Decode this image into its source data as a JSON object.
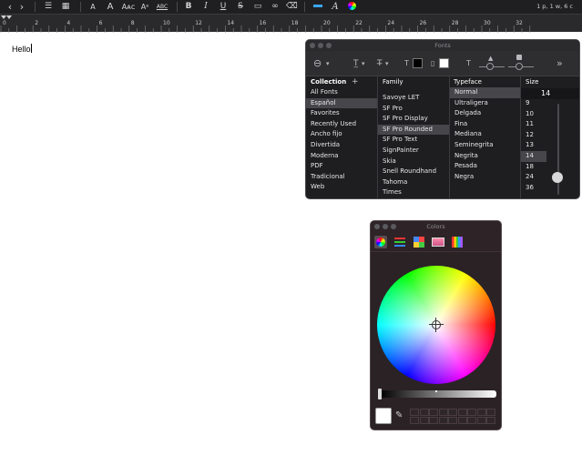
{
  "toolbar": {
    "status": "1 p, 1 w, 6 c",
    "icons": [
      "chevron-left-icon",
      "chevron-right-icon",
      "list-icon",
      "table-icon",
      "text-size-icon",
      "text-size-large-icon",
      "small-caps-icon",
      "superscript-icon",
      "strikethrough-abc-icon",
      "bold-icon",
      "italic-icon",
      "underline-icon",
      "strikethrough-icon",
      "comment-icon",
      "link-icon",
      "clear-format-icon",
      "highlight-icon",
      "font-panel-icon",
      "color-panel-icon"
    ],
    "glyph_labels": {
      "aa": "A",
      "abc_small": "Aᴀᴄ",
      "abc_strike": "ABC",
      "bold": "B",
      "italic": "I",
      "underline": "U",
      "strike": "S"
    }
  },
  "ruler": {
    "labels": [
      "0",
      "2",
      "4",
      "6",
      "8",
      "10",
      "12",
      "14",
      "16",
      "18",
      "20",
      "22",
      "24",
      "26",
      "28",
      "30",
      "32"
    ]
  },
  "document": {
    "text": "Hello"
  },
  "fonts_panel": {
    "title": "Fonts",
    "headers": {
      "collection": "Collection",
      "family": "Family",
      "typeface": "Typeface",
      "size": "Size"
    },
    "collections": [
      "All Fonts",
      "Español",
      "Favorites",
      "Recently Used",
      "Ancho fijo",
      "Divertida",
      "Moderna",
      "PDF",
      "Tradicional",
      "Web"
    ],
    "collection_selected": "Español",
    "families": [
      "Savoye LET",
      "SF Pro",
      "SF Pro Display",
      "SF Pro Rounded",
      "SF Pro Text",
      "SignPainter",
      "Skia",
      "Snell Roundhand",
      "Tahoma",
      "Times"
    ],
    "family_selected": "SF Pro Rounded",
    "typefaces": [
      "Normal",
      "Ultraligera",
      "Delgada",
      "Fina",
      "Mediana",
      "Seminegrita",
      "Negrita",
      "Pesada",
      "Negra"
    ],
    "typeface_selected": "Normal",
    "size_value": "14",
    "sizes": [
      "9",
      "10",
      "11",
      "12",
      "13",
      "14",
      "18",
      "24",
      "36"
    ],
    "size_selected": "14",
    "add_label": "+",
    "text_color": "#000000",
    "doc_color": "#ffffff"
  },
  "colors_panel": {
    "title": "Colors",
    "current_color": "#ffffff"
  }
}
